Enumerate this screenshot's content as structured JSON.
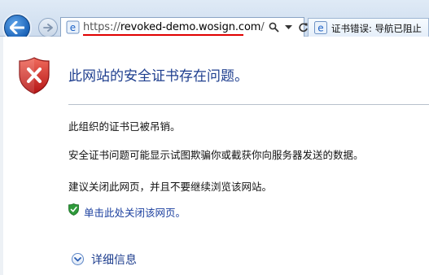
{
  "address_bar": {
    "url_scheme": "https://",
    "url_domain_prefix": "revoked-demo.",
    "url_domain": "wosign.com",
    "url_path": "/"
  },
  "tab": {
    "title": "证书错误: 导航已阻止"
  },
  "page": {
    "heading": "此网站的安全证书存在问题。",
    "revoked_text": "此组织的证书已被吊销。",
    "warning_text": "安全证书问题可能显示试图欺骗你或截获你向服务器发送的数据。",
    "advice_text": "建议关闭此网页，并且不要继续浏览该网站。",
    "close_link": "单击此处关闭该网页。",
    "more_info": "详细信息"
  },
  "colors": {
    "heading": "#1f3f8f",
    "link": "#1a3e9e",
    "error_red": "#d22b2b",
    "url_underline": "#e00000"
  },
  "icons": {
    "back": "back-arrow-icon",
    "forward": "forward-arrow-icon",
    "page": "ie-page-icon",
    "search": "search-icon",
    "dropdown": "chevron-down-icon",
    "refresh": "refresh-icon",
    "shield_error": "shield-error-icon",
    "shield_ok": "shield-check-icon",
    "expand": "chevron-down-circle-icon"
  }
}
